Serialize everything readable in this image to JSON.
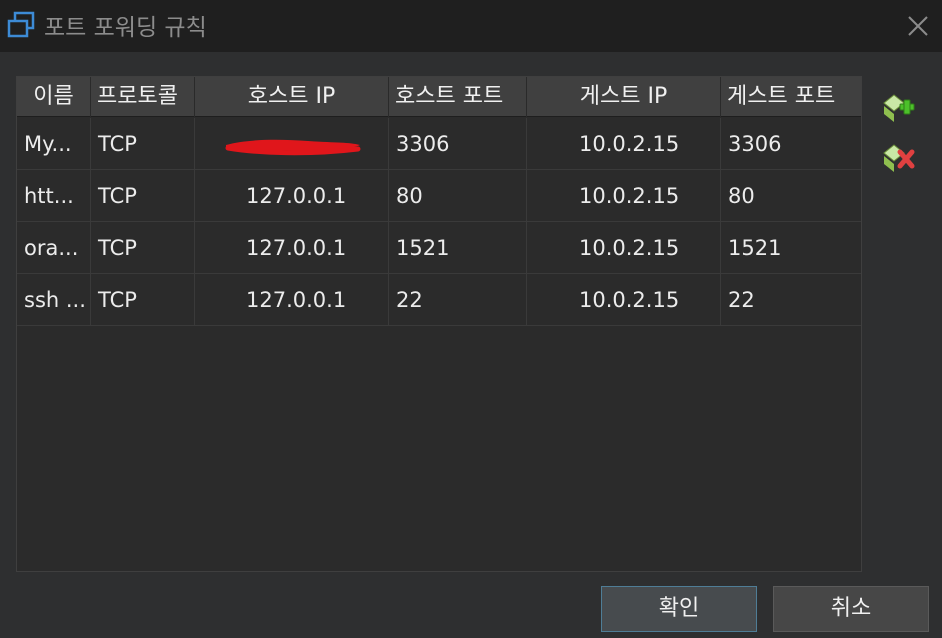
{
  "window": {
    "title": "포트 포워딩 규칙"
  },
  "table": {
    "columns": [
      "이름",
      "프로토콜",
      "호스트 IP",
      "호스트 포트",
      "게스트 IP",
      "게스트 포트"
    ],
    "rows": [
      {
        "name": "My...",
        "protocol": "TCP",
        "host_ip": "",
        "host_port": "3306",
        "guest_ip": "10.0.2.15",
        "guest_port": "3306"
      },
      {
        "name": "htt...",
        "protocol": "TCP",
        "host_ip": "127.0.0.1",
        "host_port": "80",
        "guest_ip": "10.0.2.15",
        "guest_port": "80"
      },
      {
        "name": "ora...",
        "protocol": "TCP",
        "host_ip": "127.0.0.1",
        "host_port": "1521",
        "guest_ip": "10.0.2.15",
        "guest_port": "1521"
      },
      {
        "name": "ssh ...",
        "protocol": "TCP",
        "host_ip": "127.0.0.1",
        "host_port": "22",
        "guest_ip": "10.0.2.15",
        "guest_port": "22"
      }
    ]
  },
  "side_buttons": {
    "add_icon": "add-rule-icon",
    "remove_icon": "remove-rule-icon"
  },
  "buttons": {
    "ok": "확인",
    "cancel": "취소"
  },
  "colors": {
    "accent_green": "#4cc02a",
    "remove_red": "#e04040",
    "redaction": "#e0161b",
    "ok_border": "#4f7d96"
  }
}
